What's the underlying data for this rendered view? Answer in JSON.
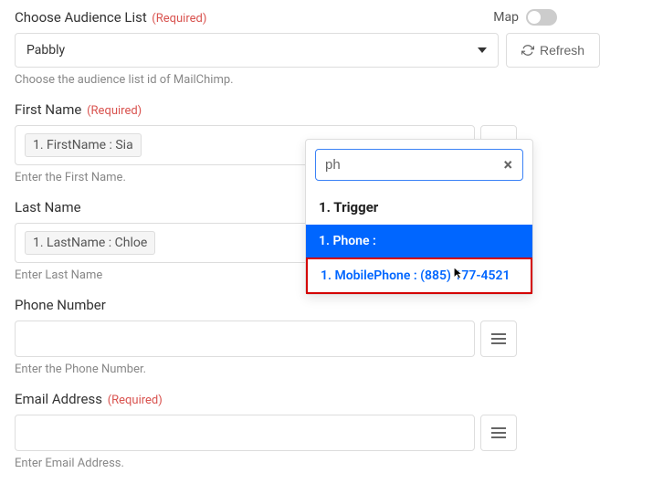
{
  "audience": {
    "label": "Choose Audience List",
    "required": "(Required)",
    "map_label": "Map",
    "value": "Pabbly",
    "refresh_label": "Refresh",
    "hint": "Choose the audience list id of MailChimp."
  },
  "first_name": {
    "label": "First Name",
    "required": "(Required)",
    "tag_value": "1. FirstName : Sia",
    "hint": "Enter the First Name."
  },
  "last_name": {
    "label": "Last Name",
    "tag_value": "1. LastName : Chloe",
    "hint": "Enter Last Name"
  },
  "phone": {
    "label": "Phone Number",
    "hint": "Enter the Phone Number."
  },
  "email": {
    "label": "Email Address",
    "required": "(Required)",
    "hint": "Enter Email Address."
  },
  "dropdown": {
    "search_value": "ph",
    "group_header": "1. Trigger",
    "item_phone": "1. Phone :",
    "item_mobile": "1. MobilePhone : (885) 177-4521"
  }
}
